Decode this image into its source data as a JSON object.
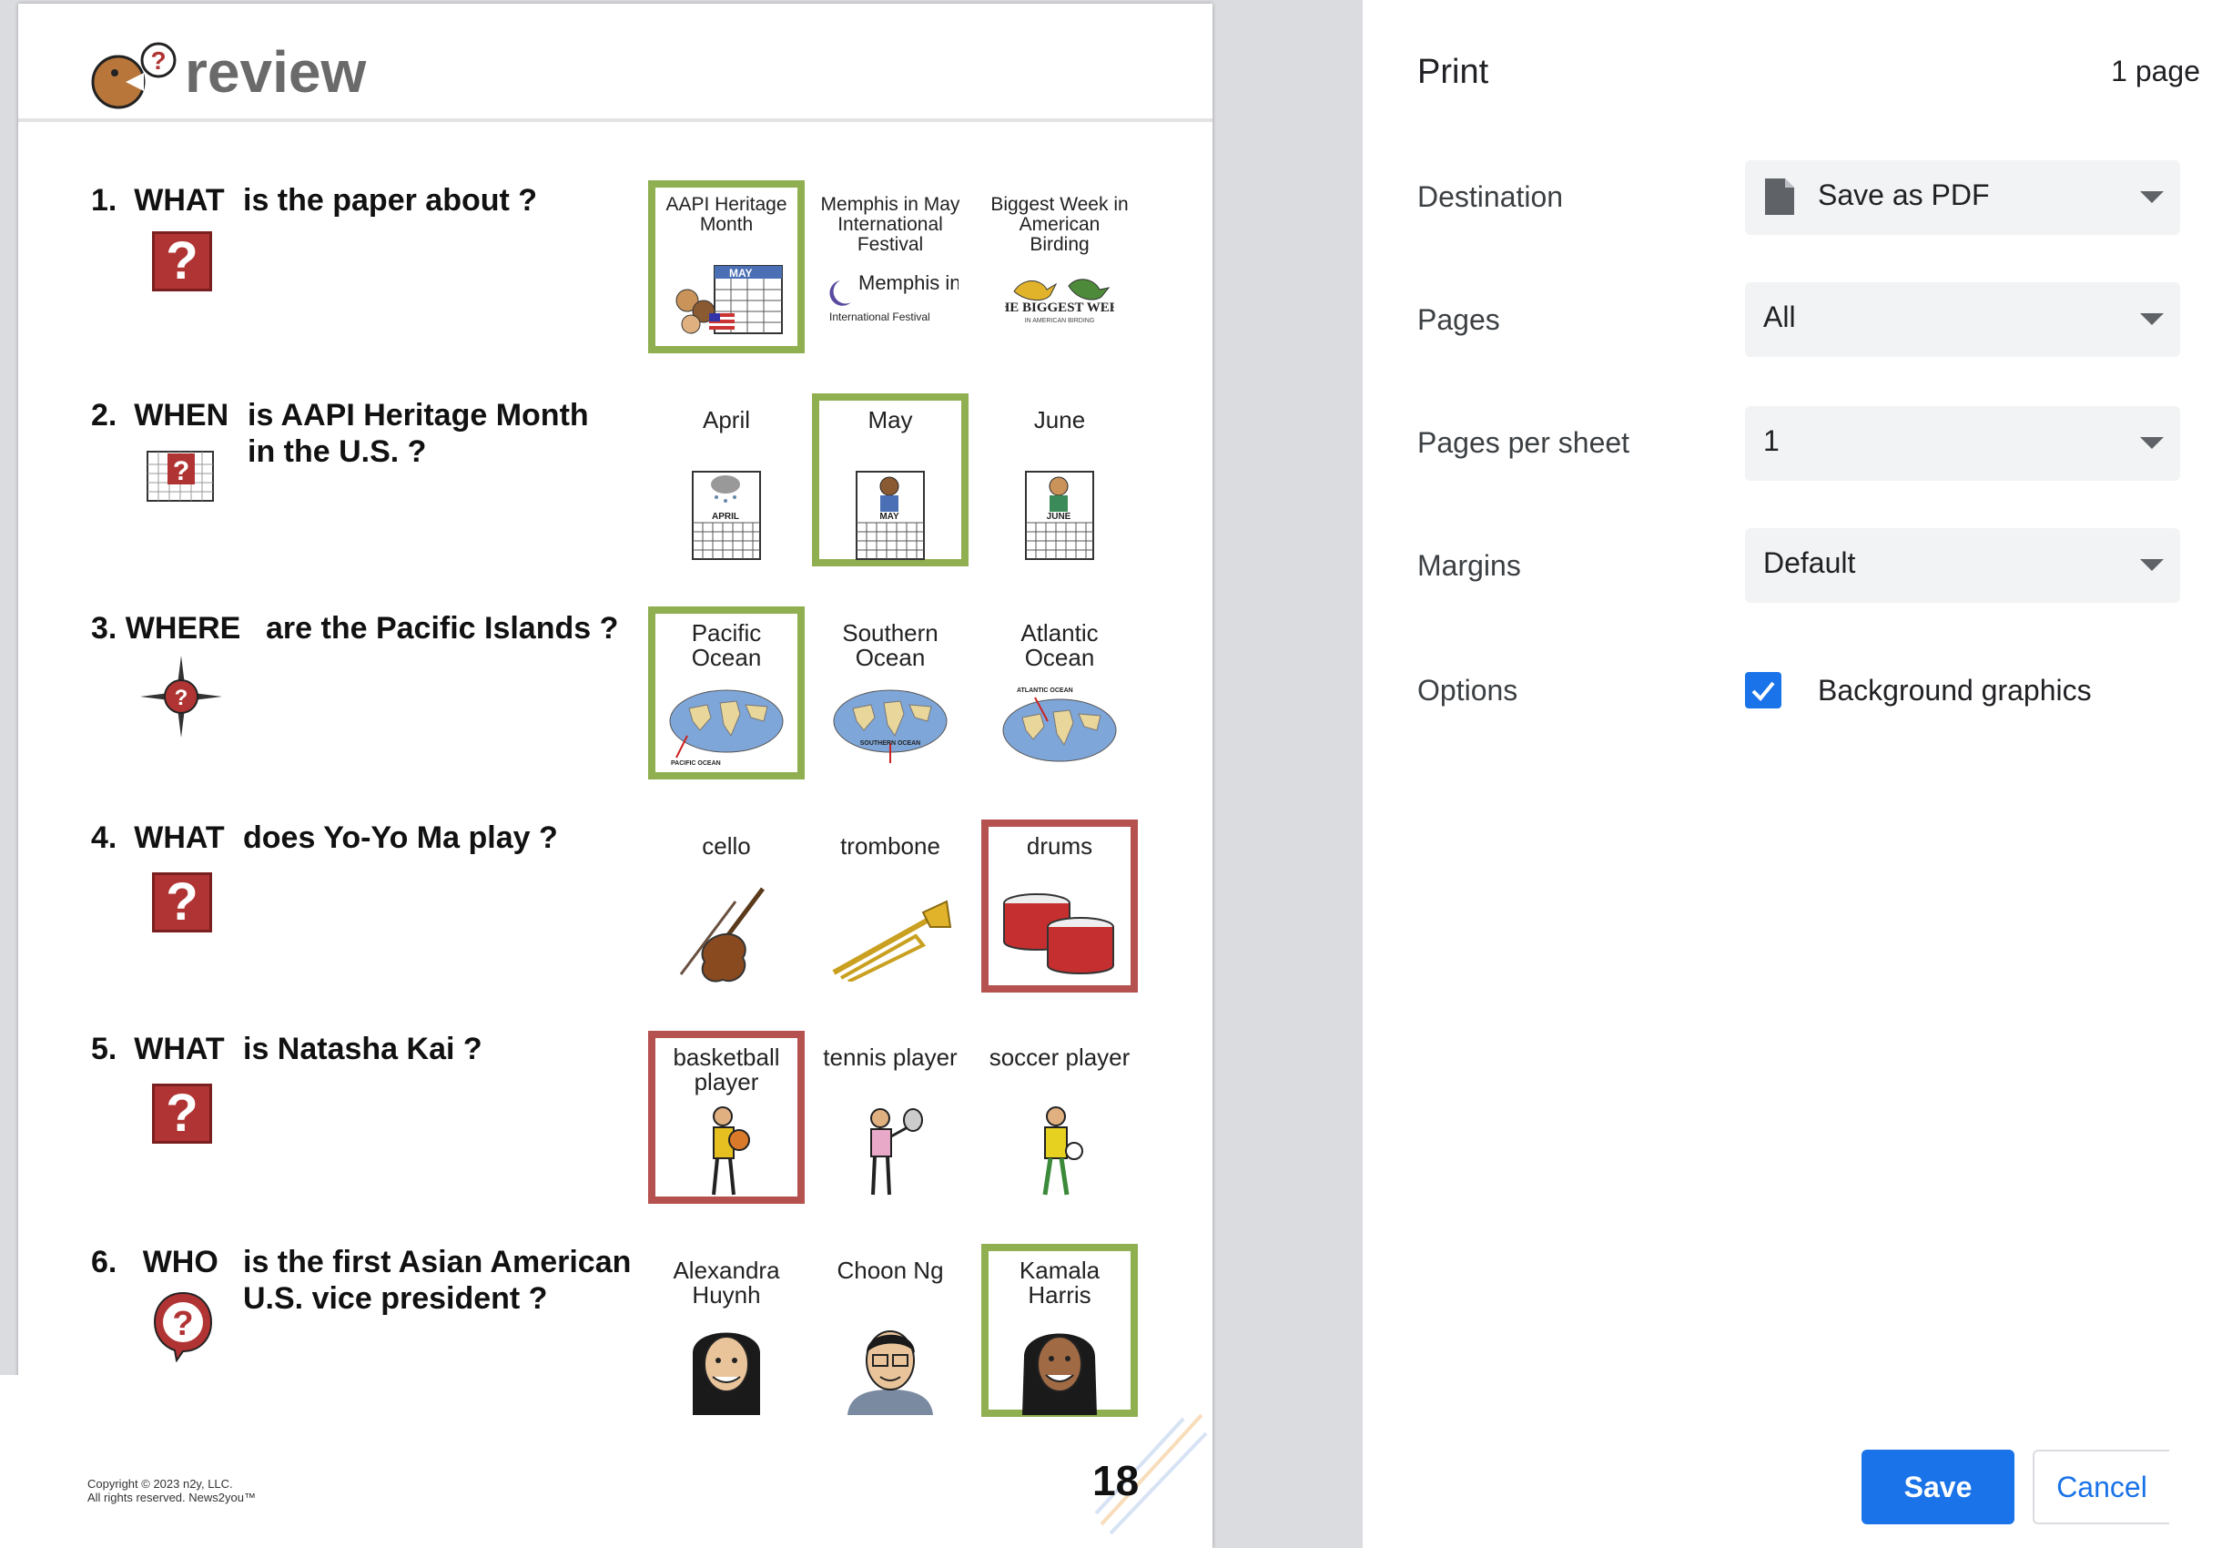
{
  "worksheet": {
    "title": "review",
    "questions": [
      {
        "number_word": "1.  WHAT",
        "text": "is the paper about ?",
        "options": [
          {
            "label": "AAPI Heritage Month",
            "mark": "correct"
          },
          {
            "label": "Memphis in May International Festival",
            "mark": "none"
          },
          {
            "label": "Biggest Week in American Birding",
            "mark": "none"
          }
        ]
      },
      {
        "number_word": "2.  WHEN",
        "text": "is AAPI Heritage Month\nin the U.S. ?",
        "options": [
          {
            "label": "April",
            "mark": "none"
          },
          {
            "label": "May",
            "mark": "correct"
          },
          {
            "label": "June",
            "mark": "none"
          }
        ]
      },
      {
        "number_word": "3. WHERE",
        "text": "are the Pacific Islands ?",
        "options": [
          {
            "label": "Pacific Ocean",
            "mark": "correct"
          },
          {
            "label": "Southern Ocean",
            "mark": "none"
          },
          {
            "label": "Atlantic Ocean",
            "mark": "none"
          }
        ]
      },
      {
        "number_word": "4.  WHAT",
        "text": "does Yo-Yo Ma play ?",
        "options": [
          {
            "label": "cello",
            "mark": "none"
          },
          {
            "label": "trombone",
            "mark": "none"
          },
          {
            "label": "drums",
            "mark": "wrong"
          }
        ]
      },
      {
        "number_word": "5.  WHAT",
        "text": "is Natasha Kai ?",
        "options": [
          {
            "label": "basketball player",
            "mark": "wrong"
          },
          {
            "label": "tennis player",
            "mark": "none"
          },
          {
            "label": "soccer player",
            "mark": "none"
          }
        ]
      },
      {
        "number_word": "6.   WHO",
        "text": "is the first Asian American\nU.S. vice president ?",
        "options": [
          {
            "label": "Alexandra Huynh",
            "mark": "none"
          },
          {
            "label": "Choon Ng",
            "mark": "none"
          },
          {
            "label": "Kamala Harris",
            "mark": "correct"
          }
        ]
      }
    ],
    "image_text": {
      "calendar_may": "MAY",
      "calendar_april": "APRIL",
      "calendar_june": "JUNE",
      "memphis_logo": "Memphis in May",
      "memphis_sub": "International Festival",
      "birding_logo": "THE BIGGEST WEEK",
      "birding_sub": "IN AMERICAN BIRDING",
      "map_pacific": "PACIFIC OCEAN",
      "map_southern": "SOUTHERN OCEAN",
      "map_atlantic": "ATLANTIC OCEAN"
    },
    "copyright_line1": "Copyright © 2023 n2y, LLC.",
    "copyright_line2": "All rights reserved. News2you™",
    "page_number": "18"
  },
  "print_panel": {
    "title": "Print",
    "page_count": "1 page",
    "destination": {
      "label": "Destination",
      "value": "Save as PDF"
    },
    "pages": {
      "label": "Pages",
      "value": "All"
    },
    "pages_per_sheet": {
      "label": "Pages per sheet",
      "value": "1"
    },
    "margins": {
      "label": "Margins",
      "value": "Default"
    },
    "options": {
      "label": "Options",
      "checkbox_label": "Background graphics",
      "checked": true
    },
    "save_label": "Save",
    "cancel_label": "Cancel"
  },
  "colors": {
    "correct_border": "#8faf50",
    "wrong_border": "#b5514f",
    "accent": "#1a73e8",
    "question_icon": "#b13434"
  }
}
